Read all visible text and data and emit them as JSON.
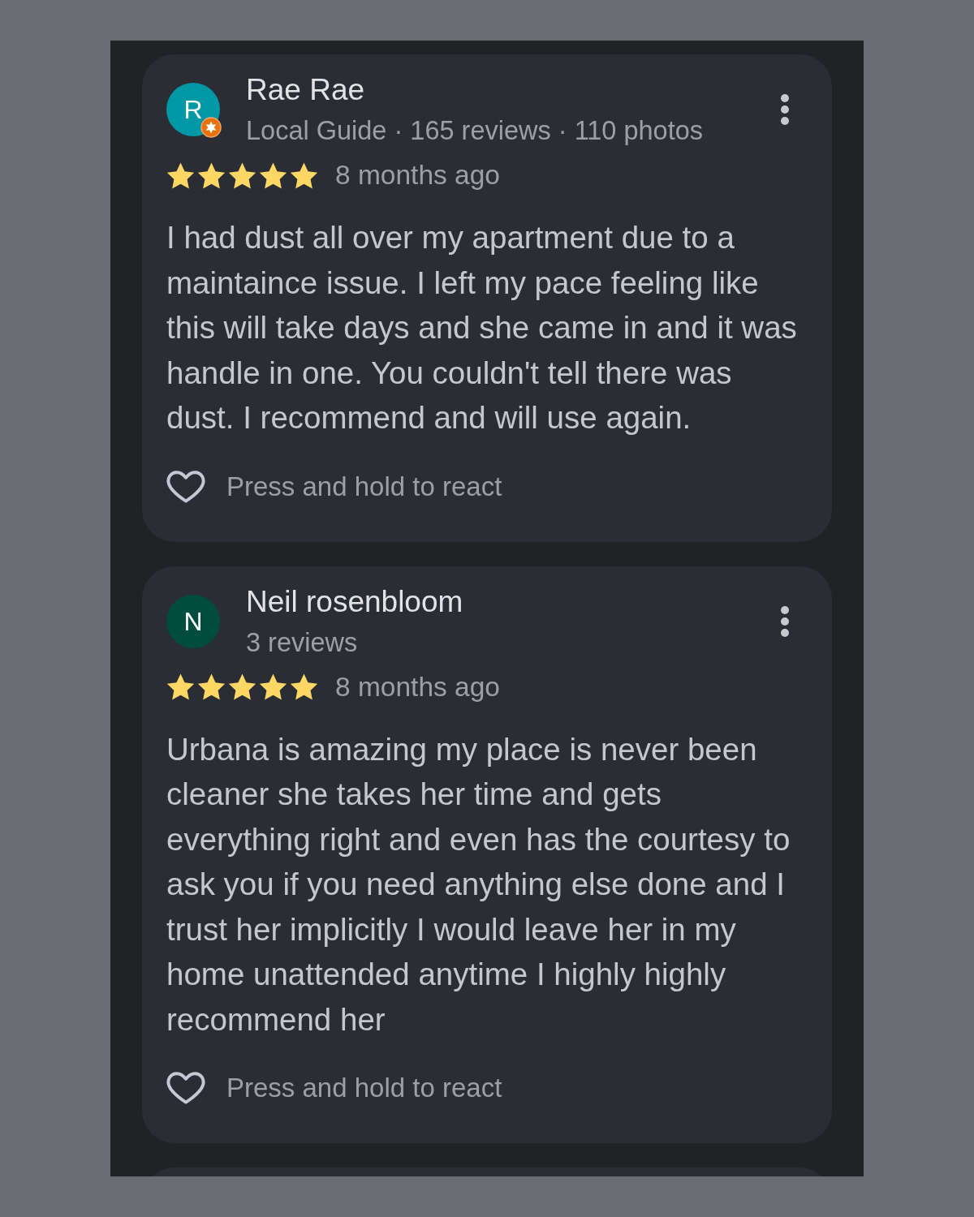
{
  "reviews": [
    {
      "author": "Rae Rae",
      "avatar": {
        "letter": "R",
        "color": "#0097a7",
        "local_guide_badge": true
      },
      "meta": "Local Guide · 165 reviews · 110 photos",
      "stars": 5,
      "time": "8 months ago",
      "text": "I had dust all over my apartment due to a maintaince issue. I left my pace feeling like this will take days and she came in and it was handle in one. You couldn't tell there was dust. I recommend and will use again.",
      "reaction_hint": "Press and hold to react"
    },
    {
      "author": "Neil rosenbloom",
      "avatar": {
        "letter": "N",
        "color": "#004d40",
        "local_guide_badge": false
      },
      "meta": "3 reviews",
      "stars": 5,
      "time": "8 months ago",
      "text": "Urbana is amazing my place is never been cleaner she takes her time and gets everything right and even has the courtesy to ask you if you need anything else done and I trust her implicitly I would leave her in my home unattended anytime I highly highly recommend her",
      "reaction_hint": "Press and hold to react"
    }
  ],
  "more_reviews_below": true
}
